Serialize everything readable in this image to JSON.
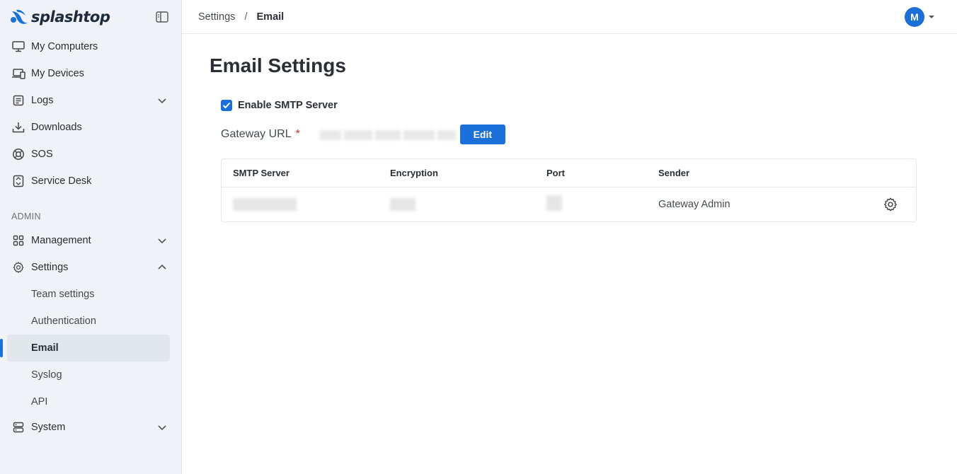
{
  "brand": {
    "name": "splashtop",
    "accent": "#1a6fd8"
  },
  "sidebar": {
    "items": [
      {
        "label": "My Computers",
        "icon": "monitor-icon"
      },
      {
        "label": "My Devices",
        "icon": "devices-icon"
      },
      {
        "label": "Logs",
        "icon": "logs-icon",
        "expandable": true,
        "expanded": false
      },
      {
        "label": "Downloads",
        "icon": "download-icon"
      },
      {
        "label": "SOS",
        "icon": "sos-icon"
      },
      {
        "label": "Service Desk",
        "icon": "service-desk-icon"
      }
    ],
    "admin_label": "ADMIN",
    "admin_items": [
      {
        "label": "Management",
        "icon": "grid-icon",
        "expandable": true,
        "expanded": false
      },
      {
        "label": "Settings",
        "icon": "gear-icon",
        "expandable": true,
        "expanded": true
      }
    ],
    "settings_sub": [
      "Team settings",
      "Authentication",
      "Email",
      "Syslog",
      "API"
    ],
    "active_sub": "Email",
    "system_item": {
      "label": "System",
      "icon": "server-icon",
      "expandable": true,
      "expanded": false
    }
  },
  "header": {
    "breadcrumb": [
      "Settings",
      "Email"
    ],
    "separator": "/",
    "avatar_initial": "M"
  },
  "main": {
    "title": "Email Settings",
    "enable_smtp": {
      "label": "Enable SMTP Server",
      "checked": true
    },
    "gateway_url": {
      "label": "Gateway URL",
      "required_mark": "*",
      "edit_label": "Edit"
    },
    "table": {
      "columns": [
        "SMTP Server",
        "Encryption",
        "Port",
        "Sender"
      ],
      "rows": [
        {
          "sender": "Gateway Admin"
        }
      ]
    }
  }
}
